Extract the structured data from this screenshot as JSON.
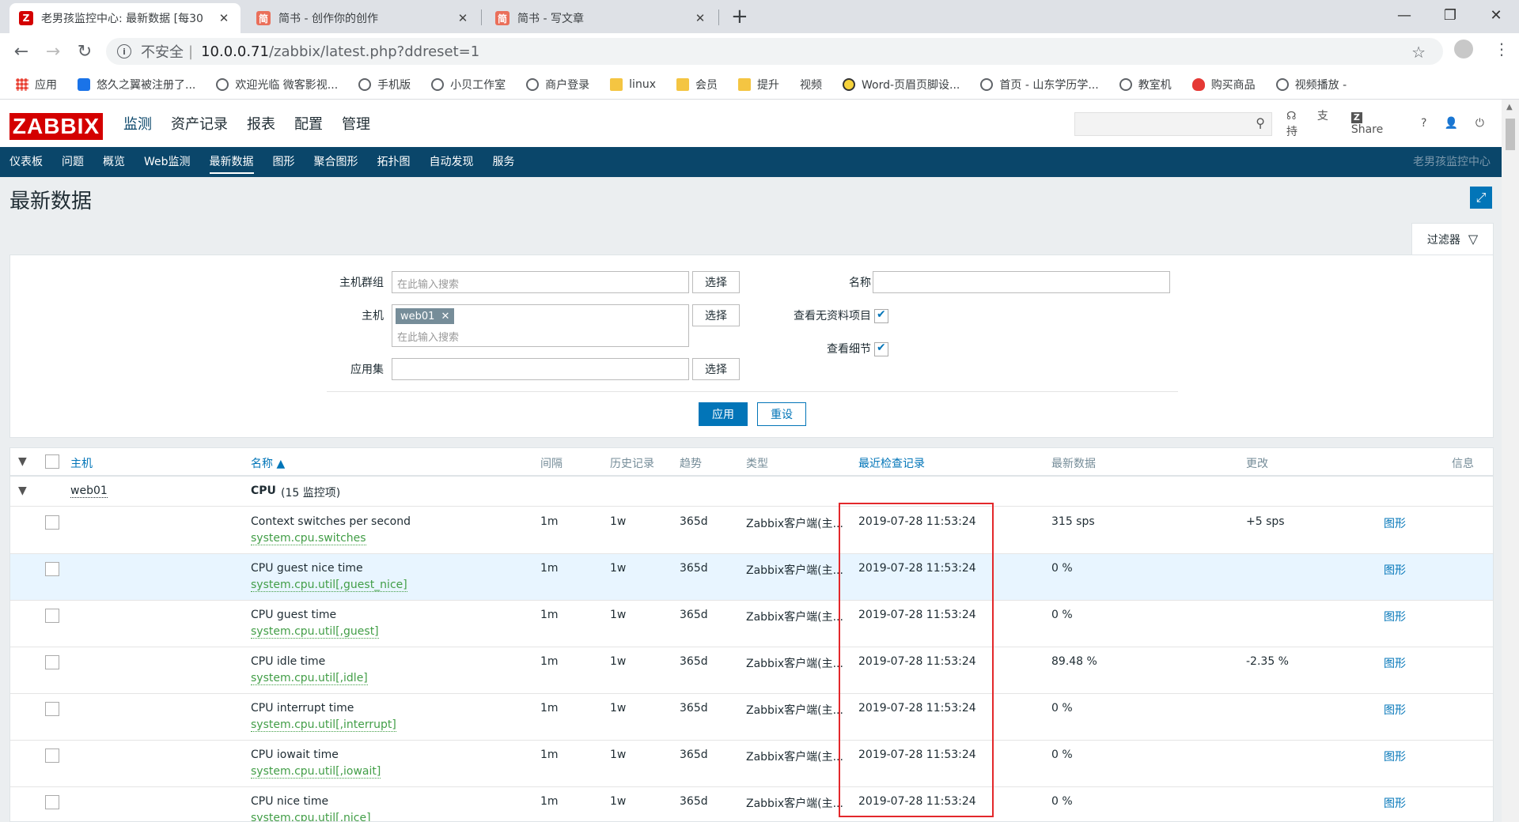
{
  "browser": {
    "tabs": [
      {
        "title": "老男孩监控中心: 最新数据 [每30",
        "favicon_text": "Z",
        "favicon_color": "#d40000"
      },
      {
        "title": "简书 - 创作你的创作",
        "favicon_text": "简",
        "favicon_color": "#ea6f5a"
      },
      {
        "title": "简书 - 写文章",
        "favicon_text": "简",
        "favicon_color": "#ea6f5a"
      }
    ],
    "new_tab": "+",
    "insecure_label": "不安全",
    "url_host": "10.0.0.71",
    "url_path": "/zabbix/latest.php?ddreset=1",
    "bookmarks": [
      {
        "label": "应用",
        "icon": "grid-icon"
      },
      {
        "label": "悠久之翼被注册了...",
        "icon": "bilibili-icon"
      },
      {
        "label": "欢迎光临 微客影视...",
        "icon": "globe-icon"
      },
      {
        "label": "手机版",
        "icon": "globe-icon"
      },
      {
        "label": "小贝工作室",
        "icon": "globe-icon"
      },
      {
        "label": "商户登录",
        "icon": "globe-icon"
      },
      {
        "label": "linux",
        "icon": "folder-icon"
      },
      {
        "label": "会员",
        "icon": "folder-icon"
      },
      {
        "label": "提升",
        "icon": "folder-icon"
      },
      {
        "label": "视频",
        "icon": "none"
      },
      {
        "label": "Word-页眉页脚设...",
        "icon": "face-icon"
      },
      {
        "label": "首页 - 山东学历学...",
        "icon": "globe-icon"
      },
      {
        "label": "教室机",
        "icon": "globe-icon"
      },
      {
        "label": "购买商品",
        "icon": "qq-icon"
      },
      {
        "label": "视频播放 -",
        "icon": "globe-icon"
      }
    ]
  },
  "header": {
    "logo": "ZABBIX",
    "menu": [
      "监测",
      "资产记录",
      "报表",
      "配置",
      "管理"
    ],
    "support": "支持",
    "share": "Share",
    "help": "?"
  },
  "subnav": {
    "items": [
      "仪表板",
      "问题",
      "概览",
      "Web监测",
      "最新数据",
      "图形",
      "聚合图形",
      "拓扑图",
      "自动发现",
      "服务"
    ],
    "right": "老男孩监控中心"
  },
  "page_title": "最新数据",
  "filter": {
    "tab_label": "过滤器",
    "host_group_label": "主机群组",
    "host_group_placeholder": "在此输入搜索",
    "host_label": "主机",
    "host_chip": "web01",
    "host_placeholder": "在此输入搜索",
    "app_label": "应用集",
    "select_label": "选择",
    "name_label": "名称",
    "show_no_data_label": "查看无资料项目",
    "show_details_label": "查看细节",
    "apply": "应用",
    "reset": "重设"
  },
  "table": {
    "headers": {
      "host": "主机",
      "name": "名称 ▲",
      "interval": "间隔",
      "history": "历史记录",
      "trends": "趋势",
      "type": "类型",
      "last_check": "最近检查记录",
      "last_value": "最新数据",
      "change": "更改",
      "info": "信息"
    },
    "group": {
      "host": "web01",
      "app": "CPU",
      "count": "(15 监控项)"
    },
    "rows": [
      {
        "name": "Context switches per second",
        "key": "system.cpu.switches",
        "interval": "1m",
        "history": "1w",
        "trends": "365d",
        "type": "Zabbix客户端(主...",
        "last_check": "2019-07-28 11:53:24",
        "last_value": "315 sps",
        "change": "+5 sps",
        "graph": "图形"
      },
      {
        "name": "CPU guest nice time",
        "key": "system.cpu.util[,guest_nice]",
        "interval": "1m",
        "history": "1w",
        "trends": "365d",
        "type": "Zabbix客户端(主...",
        "last_check": "2019-07-28 11:53:24",
        "last_value": "0 %",
        "change": "",
        "graph": "图形"
      },
      {
        "name": "CPU guest time",
        "key": "system.cpu.util[,guest]",
        "interval": "1m",
        "history": "1w",
        "trends": "365d",
        "type": "Zabbix客户端(主...",
        "last_check": "2019-07-28 11:53:24",
        "last_value": "0 %",
        "change": "",
        "graph": "图形"
      },
      {
        "name": "CPU idle time",
        "key": "system.cpu.util[,idle]",
        "interval": "1m",
        "history": "1w",
        "trends": "365d",
        "type": "Zabbix客户端(主...",
        "last_check": "2019-07-28 11:53:24",
        "last_value": "89.48 %",
        "change": "-2.35 %",
        "graph": "图形"
      },
      {
        "name": "CPU interrupt time",
        "key": "system.cpu.util[,interrupt]",
        "interval": "1m",
        "history": "1w",
        "trends": "365d",
        "type": "Zabbix客户端(主...",
        "last_check": "2019-07-28 11:53:24",
        "last_value": "0 %",
        "change": "",
        "graph": "图形"
      },
      {
        "name": "CPU iowait time",
        "key": "system.cpu.util[,iowait]",
        "interval": "1m",
        "history": "1w",
        "trends": "365d",
        "type": "Zabbix客户端(主...",
        "last_check": "2019-07-28 11:53:24",
        "last_value": "0 %",
        "change": "",
        "graph": "图形"
      },
      {
        "name": "CPU nice time",
        "key": "system.cpu.util[,nice]",
        "interval": "1m",
        "history": "1w",
        "trends": "365d",
        "type": "Zabbix客户端(主...",
        "last_check": "2019-07-28 11:53:24",
        "last_value": "0 %",
        "change": "",
        "graph": "图形"
      }
    ]
  },
  "colors": {
    "brand_red": "#d40000",
    "nav_blue": "#0a466a",
    "link_blue": "#0275b8",
    "key_green": "#429e47",
    "highlight_box": "#e3282b"
  }
}
